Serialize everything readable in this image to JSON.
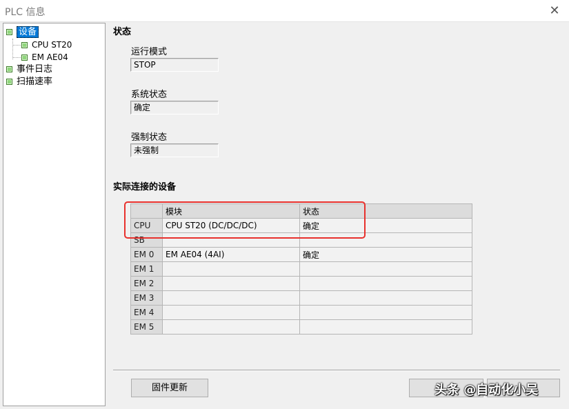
{
  "window": {
    "title": "PLC 信息",
    "close_glyph": "✕"
  },
  "tree": {
    "items": [
      {
        "label": "设备",
        "icon": "module-icon"
      },
      {
        "label": "CPU ST20",
        "icon": "module-icon"
      },
      {
        "label": "EM AE04",
        "icon": "module-icon"
      },
      {
        "label": "事件日志",
        "icon": "module-icon"
      },
      {
        "label": "扫描速率",
        "icon": "module-icon"
      }
    ]
  },
  "status": {
    "section_title": "状态",
    "run_mode": {
      "label": "运行模式",
      "value": "STOP"
    },
    "system_status": {
      "label": "系统状态",
      "value": "确定"
    },
    "force_status": {
      "label": "强制状态",
      "value": "未强制"
    }
  },
  "devices": {
    "section_title": "实际连接的设备",
    "headers": [
      "",
      "模块",
      "状态"
    ],
    "rows": [
      [
        "CPU",
        "CPU ST20 (DC/DC/DC)",
        "确定"
      ],
      [
        "SB",
        "",
        ""
      ],
      [
        "EM 0",
        "EM AE04 (4AI)",
        "确定"
      ],
      [
        "EM 1",
        "",
        ""
      ],
      [
        "EM 2",
        "",
        ""
      ],
      [
        "EM 3",
        "",
        ""
      ],
      [
        "EM 4",
        "",
        ""
      ],
      [
        "EM 5",
        "",
        ""
      ]
    ]
  },
  "buttons": {
    "firmware_update": "固件更新",
    "btn2_partial": "",
    "btn3_partial": ""
  },
  "watermark": "头条 @自动化小吴",
  "colors": {
    "highlight": "#e8302c",
    "tree_icon": "#8ed67a",
    "selection": "#0078d7"
  }
}
